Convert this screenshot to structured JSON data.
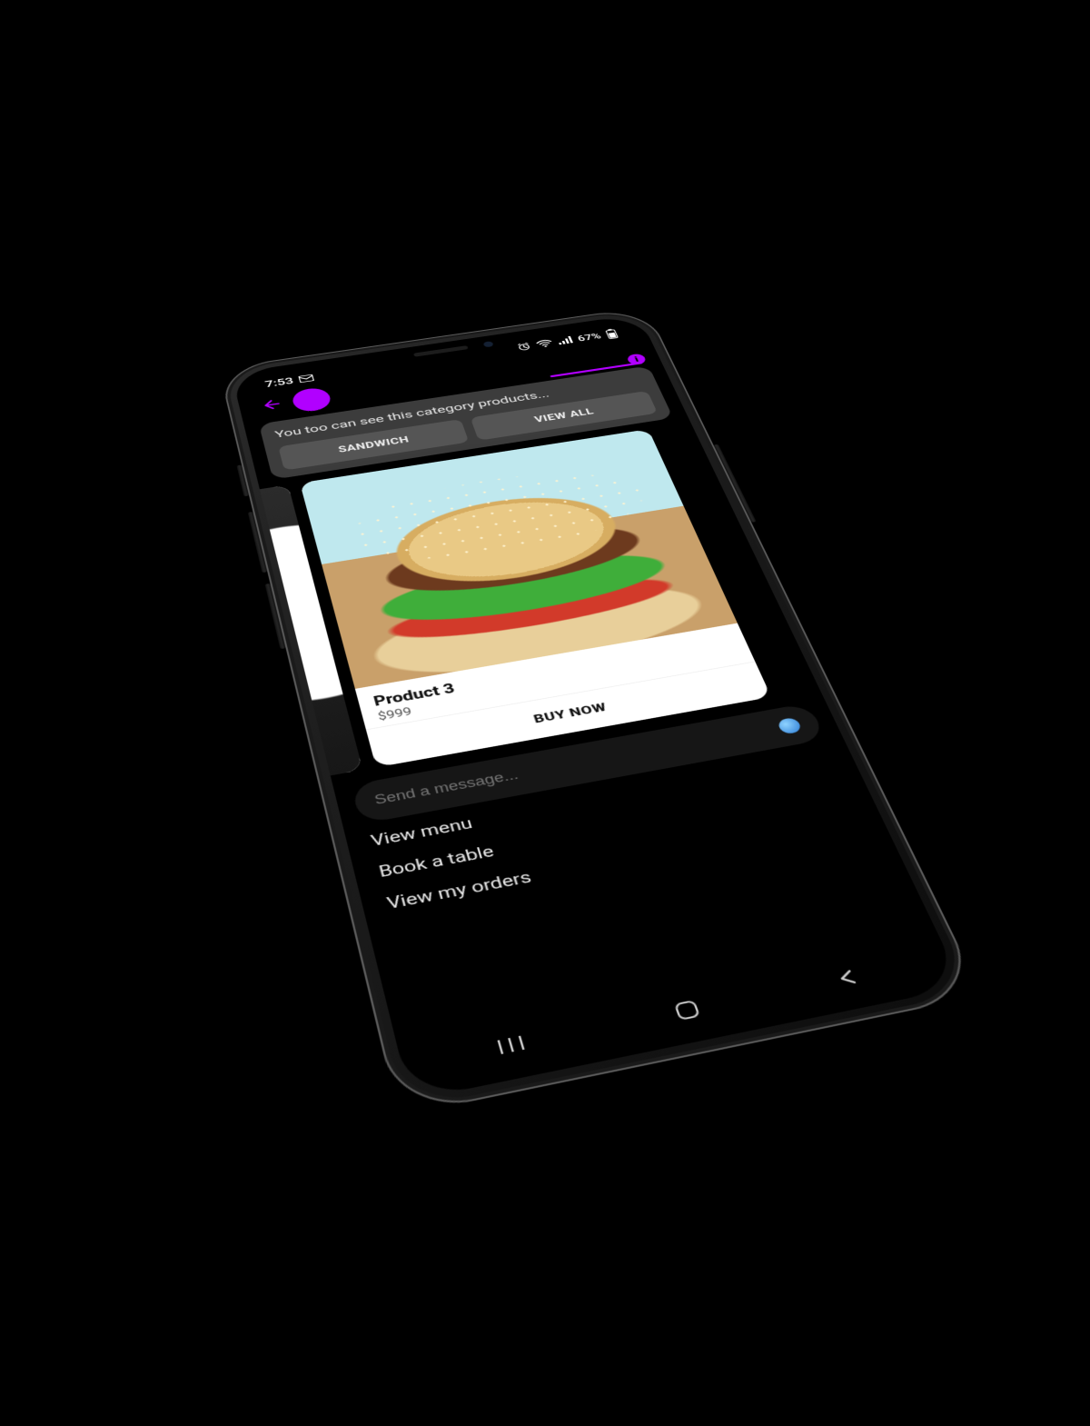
{
  "status": {
    "time": "7:53",
    "battery_text": "67%"
  },
  "bot": {
    "message": "You too can see this category products...",
    "chips": {
      "sandwich": "SANDWICH",
      "view_all": "VIEW ALL"
    }
  },
  "product": {
    "name": "Product 3",
    "price": "$999",
    "buy_label": "BUY NOW"
  },
  "composer": {
    "placeholder": "Send a message..."
  },
  "quick_actions": {
    "view_menu": "View menu",
    "book_table": "Book a table",
    "view_orders": "View my orders"
  },
  "nav": {
    "recents": "III"
  },
  "colors": {
    "accent": "#b100ff"
  }
}
